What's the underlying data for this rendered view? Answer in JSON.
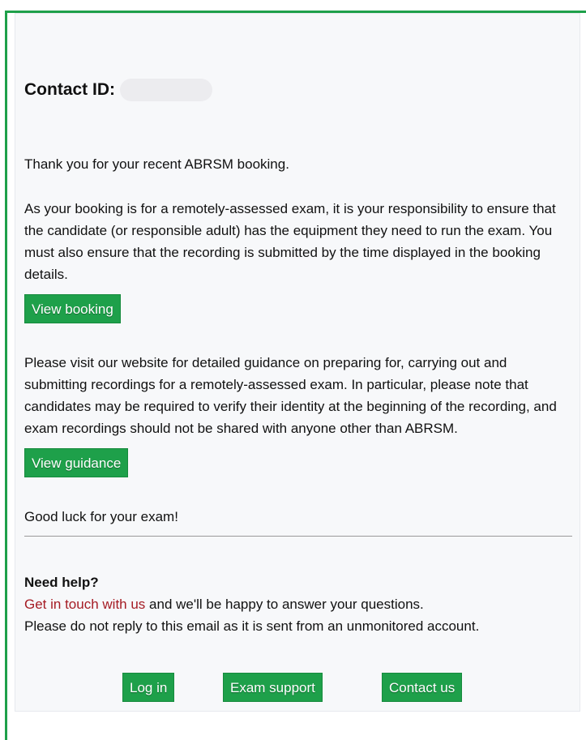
{
  "contact": {
    "label": "Contact ID:",
    "value": ""
  },
  "body": {
    "thank_you": "Thank you for your recent ABRSM booking.",
    "responsibility": "As your booking is for a remotely-assessed exam, it is your responsibility to ensure that the candidate (or responsible adult) has the equipment they need to run the exam. You must also ensure that the recording is submitted by the time displayed in the booking details.",
    "view_booking_label": "View booking",
    "guidance": "Please visit our website for detailed guidance on preparing for, carrying out and submitting recordings for a remotely-assessed exam. In particular, please note that candidates may be required to verify their identity at the beginning of the recording, and exam recordings should not be shared with anyone other than ABRSM.",
    "view_guidance_label": "View guidance",
    "good_luck": "Good luck for your exam!"
  },
  "help": {
    "title": "Need help?",
    "link_text": "Get in touch with us",
    "after_link": " and we'll be happy to answer your questions.",
    "no_reply": "Please do not reply to this email as it is sent from an unmonitored account."
  },
  "footer": {
    "login_label": "Log in",
    "exam_support_label": "Exam support",
    "contact_us_label": "Contact us"
  },
  "colors": {
    "button_green": "#1ea04a",
    "link_red": "#a51c24",
    "frame_green": "#1ea04a"
  }
}
